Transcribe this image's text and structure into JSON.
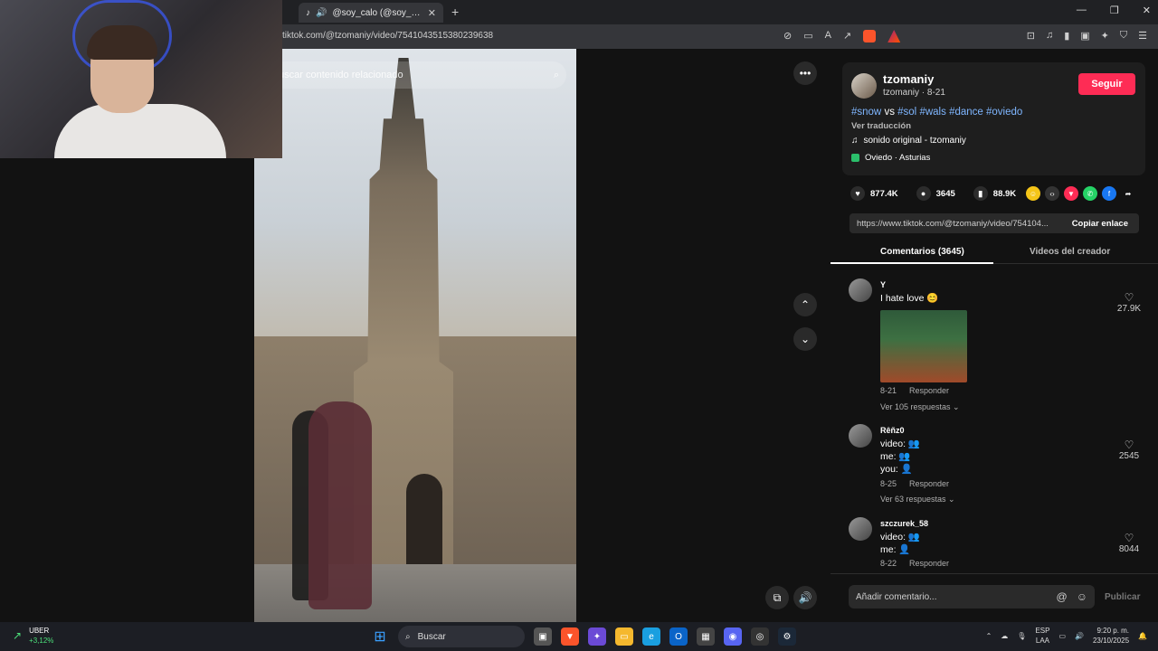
{
  "browser": {
    "tab_title": "@soy_calo (@soy_calo) | TikTok",
    "url": "tiktok.com/@tzomaniy/video/7541043515380239638"
  },
  "video": {
    "search_placeholder": "uscar contenido relacionado"
  },
  "post": {
    "username": "tzomaniy",
    "subline": "tzomaniy · 8-21",
    "follow_label": "Seguir",
    "desc_parts": [
      "#snow",
      " vs ",
      "#sol",
      " ",
      "#wals",
      " ",
      "#dance",
      " ",
      "#oviedo"
    ],
    "translate_label": "Ver traducción",
    "music": "sonido original - tzomaniy",
    "location": "Oviedo · Asturias",
    "likes": "877.4K",
    "comments": "3645",
    "saves": "88.9K",
    "link": "https://www.tiktok.com/@tzomaniy/video/754104...",
    "copy_label": "Copiar enlace"
  },
  "tabs": {
    "comments": "Comentarios (3645)",
    "creator_videos": "Videos del creador"
  },
  "comments": [
    {
      "user": "Y",
      "lines": [
        "I hate love 😊"
      ],
      "date": "8-21",
      "reply": "Responder",
      "replies": "Ver 105 respuestas ⌄",
      "likes": "27.9K"
    },
    {
      "user": "Rêñz0",
      "lines": [
        "video: 👥",
        "me: 👥",
        "you: 👤"
      ],
      "date": "8-25",
      "reply": "Responder",
      "replies": "Ver 63 respuestas ⌄",
      "likes": "2545"
    },
    {
      "user": "szczurek_58",
      "lines": [
        "video: 👥",
        "me: 👤"
      ],
      "date": "8-22",
      "reply": "Responder",
      "replies": "",
      "likes": "8044"
    }
  ],
  "add_comment": {
    "placeholder": "Añadir comentario...",
    "publish": "Publicar"
  },
  "taskbar": {
    "stock_name": "UBER",
    "stock_change": "+3,12%",
    "search": "Buscar",
    "lang1": "ESP",
    "lang2": "LAA",
    "time": "9:20 p. m.",
    "date": "23/10/2025"
  },
  "colors": {
    "follow": "#fe2c55",
    "hashtag": "#7fb6ff"
  }
}
